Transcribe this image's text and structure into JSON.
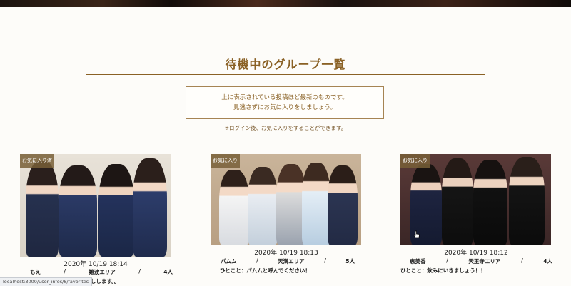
{
  "header": {
    "title": "待機中のグループ一覧"
  },
  "notice": {
    "line1": "上に表示されている投稿ほど最新のものです。",
    "line2": "見逃さずにお気に入りをしましょう。"
  },
  "login_note": "※ログイン後、お気に入りをすることができます。",
  "cards": [
    {
      "favorite_label": "お気に入り済",
      "datetime": "2020年 10/19 18:14",
      "name": "もえ",
      "separator": "/",
      "area": "難波エリア",
      "count": "4人",
      "comment": "しします。。"
    },
    {
      "favorite_label": "お気に入り",
      "datetime": "2020年 10/19 18:13",
      "name": "パムム",
      "separator": "/",
      "area": "天満エリア",
      "count": "5人",
      "comment": "ひとこと：パムムと呼んでください！"
    },
    {
      "favorite_label": "お気に入り",
      "datetime": "2020年 10/19 18:12",
      "name": "恵美香",
      "separator": "/",
      "area": "天王寺エリア",
      "count": "4人",
      "comment": "ひとこと：飲みにいきましょう！！"
    }
  ],
  "status_bar": {
    "url": "localhost:3000/user_infos/8/favorites"
  },
  "colors": {
    "accent": "#8a6125",
    "background": "#fdfcf9"
  }
}
